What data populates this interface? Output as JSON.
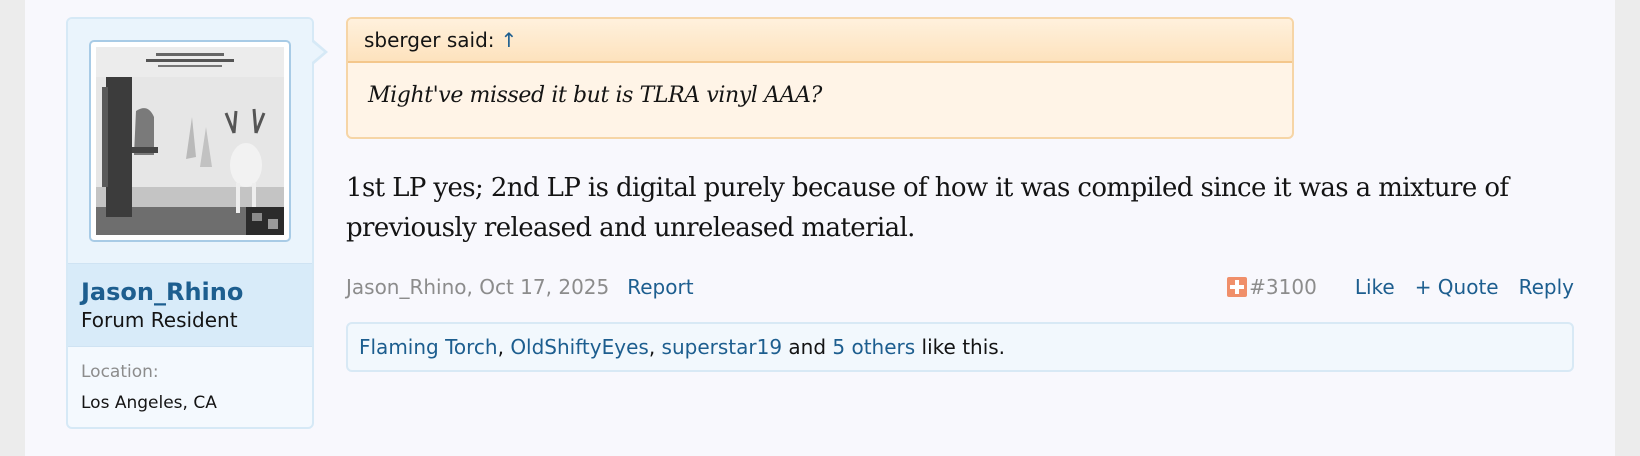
{
  "user": {
    "name": "Jason_Rhino",
    "title": "Forum Resident",
    "location_label": "Location:",
    "location_value": "Los Angeles, CA"
  },
  "quote": {
    "author_text": "sberger said:",
    "jump_arrow": "↑",
    "text": "Might've missed it but is TLRA vinyl AAA?"
  },
  "message": {
    "text": "1st LP yes; 2nd LP is digital purely because of how it was compiled since it was a mixture of previously released and unreleased material."
  },
  "meta": {
    "author_date": "Jason_Rhino, Oct 17, 2025",
    "report": "Report",
    "post_number": "#3100",
    "like": "Like",
    "quote": "+ Quote",
    "reply": "Reply"
  },
  "likes": {
    "user1": "Flaming Torch",
    "sep1": ", ",
    "user2": "OldShiftyEyes",
    "sep2": ", ",
    "user3": "superstar19",
    "and": " and ",
    "others": "5 others",
    "suffix": " like this."
  },
  "colors": {
    "link": "#1d5e8f",
    "quote_bg": "#fff4e7",
    "panel_bg": "#d8ebf9"
  }
}
